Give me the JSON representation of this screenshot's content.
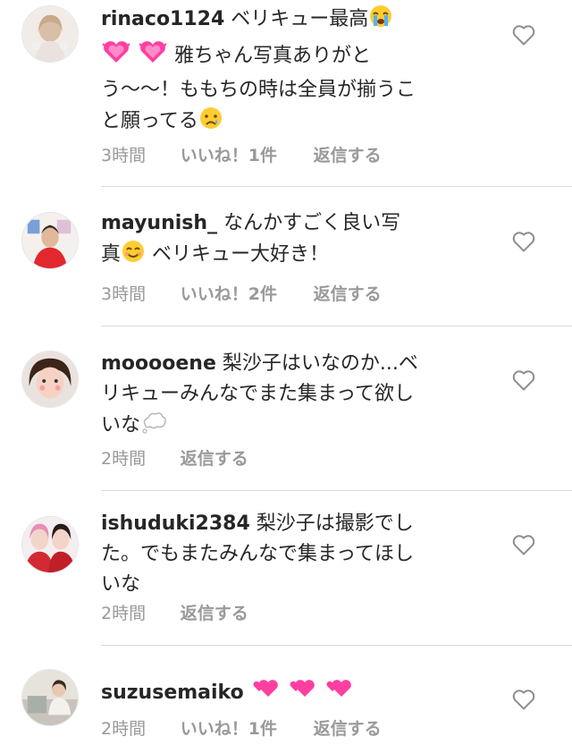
{
  "comments": [
    {
      "username": "rinaco1124",
      "text_parts": [
        "ベリキュー最高",
        "雅ちゃん写真ありがと",
        "う〜〜！ももちの時は全員が揃うこ",
        "と願ってる"
      ],
      "time": "3時間",
      "likes": "いいね！1件",
      "reply": "返信する",
      "avatar_icon": "avatar-photo-icon"
    },
    {
      "username": "mayunish_",
      "text_parts": [
        "なんかすごく良い写",
        "真",
        "ベリキュー大好き！"
      ],
      "time": "3時間",
      "likes": "いいね！2件",
      "reply": "返信する",
      "avatar_icon": "avatar-photo-icon"
    },
    {
      "username": "mooooene",
      "text_parts": [
        "梨沙子はいなのか...ベ",
        "リキューみんなでまた集まって欲し",
        "いな"
      ],
      "time": "2時間",
      "reply": "返信する",
      "avatar_icon": "avatar-photo-icon"
    },
    {
      "username": "ishuduki2384",
      "text_parts": [
        "梨沙子は撮影でし",
        "た。でもまたみんなで集まってほし",
        "いな"
      ],
      "time": "2時間",
      "reply": "返信する",
      "avatar_icon": "avatar-photo-icon"
    },
    {
      "username": "suzusemaiko",
      "text_parts": [],
      "time": "2時間",
      "likes": "いいね！1件",
      "reply": "返信する",
      "avatar_icon": "avatar-photo-icon"
    }
  ],
  "icons": {
    "like": "heart-outline-icon",
    "emoji_sob": "loudly-crying-face-icon",
    "emoji_heart": "growing-heart-icon",
    "emoji_cry": "crying-face-icon",
    "emoji_smile": "smiling-face-icon",
    "emoji_thought": "thought-balloon-icon",
    "emoji_two_hearts": "two-hearts-icon"
  },
  "colors": {
    "text": "#262626",
    "meta": "#999999",
    "divider": "#dbdbdb",
    "heart_pink": "#ff3fa0"
  }
}
